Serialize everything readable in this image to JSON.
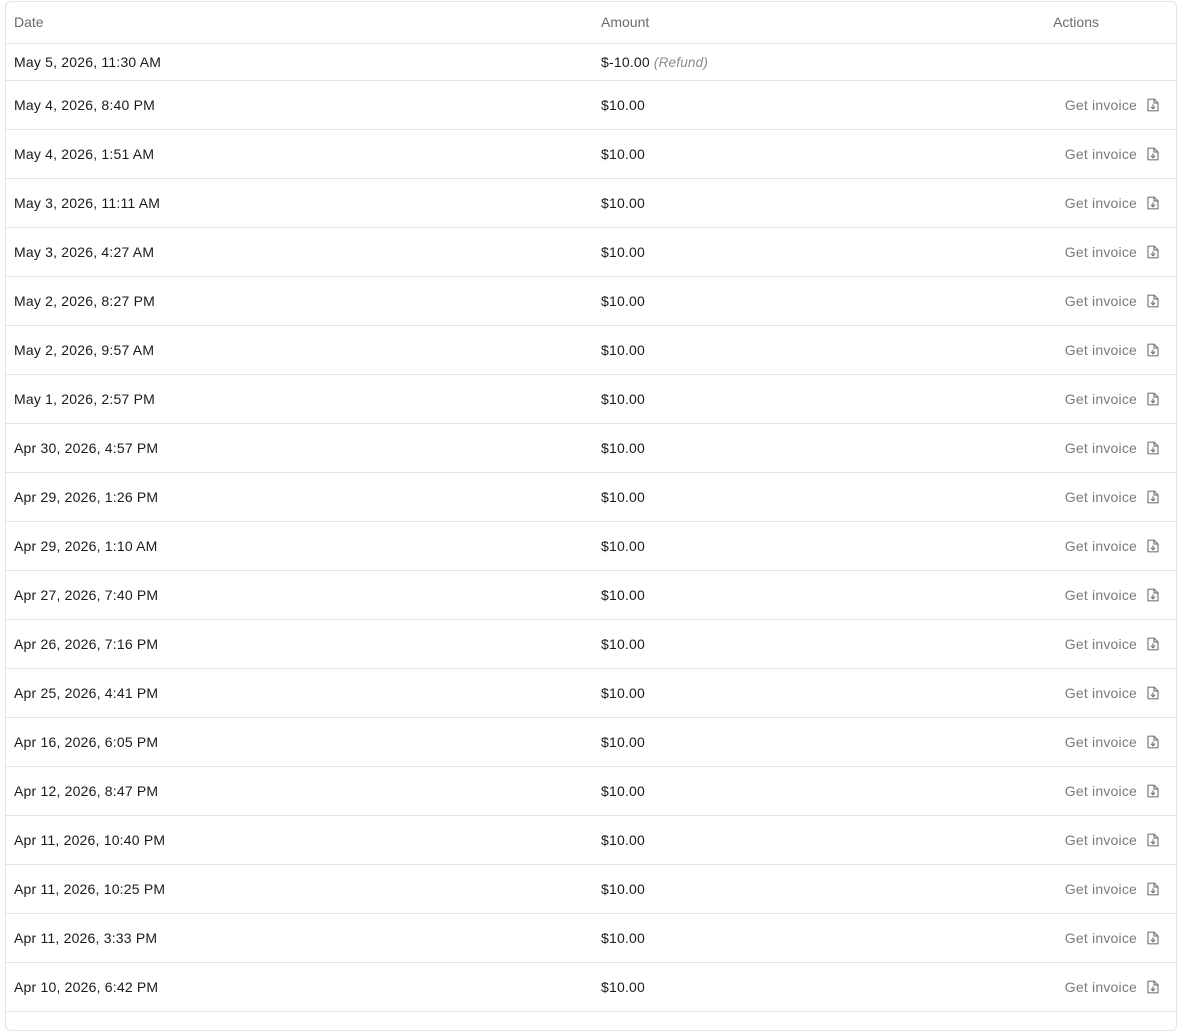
{
  "table": {
    "headers": {
      "date": "Date",
      "amount": "Amount",
      "actions": "Actions"
    },
    "rows": [
      {
        "date": "May 5, 2026, 11:30 AM",
        "amount": "$-10.00",
        "note": "(Refund)",
        "action": ""
      },
      {
        "date": "May 4, 2026, 8:40 PM",
        "amount": "$10.00",
        "note": "",
        "action": "Get invoice"
      },
      {
        "date": "May 4, 2026, 1:51 AM",
        "amount": "$10.00",
        "note": "",
        "action": "Get invoice"
      },
      {
        "date": "May 3, 2026, 11:11 AM",
        "amount": "$10.00",
        "note": "",
        "action": "Get invoice"
      },
      {
        "date": "May 3, 2026, 4:27 AM",
        "amount": "$10.00",
        "note": "",
        "action": "Get invoice"
      },
      {
        "date": "May 2, 2026, 8:27 PM",
        "amount": "$10.00",
        "note": "",
        "action": "Get invoice"
      },
      {
        "date": "May 2, 2026, 9:57 AM",
        "amount": "$10.00",
        "note": "",
        "action": "Get invoice"
      },
      {
        "date": "May 1, 2026, 2:57 PM",
        "amount": "$10.00",
        "note": "",
        "action": "Get invoice"
      },
      {
        "date": "Apr 30, 2026, 4:57 PM",
        "amount": "$10.00",
        "note": "",
        "action": "Get invoice"
      },
      {
        "date": "Apr 29, 2026, 1:26 PM",
        "amount": "$10.00",
        "note": "",
        "action": "Get invoice"
      },
      {
        "date": "Apr 29, 2026, 1:10 AM",
        "amount": "$10.00",
        "note": "",
        "action": "Get invoice"
      },
      {
        "date": "Apr 27, 2026, 7:40 PM",
        "amount": "$10.00",
        "note": "",
        "action": "Get invoice"
      },
      {
        "date": "Apr 26, 2026, 7:16 PM",
        "amount": "$10.00",
        "note": "",
        "action": "Get invoice"
      },
      {
        "date": "Apr 25, 2026, 4:41 PM",
        "amount": "$10.00",
        "note": "",
        "action": "Get invoice"
      },
      {
        "date": "Apr 16, 2026, 6:05 PM",
        "amount": "$10.00",
        "note": "",
        "action": "Get invoice"
      },
      {
        "date": "Apr 12, 2026, 8:47 PM",
        "amount": "$10.00",
        "note": "",
        "action": "Get invoice"
      },
      {
        "date": "Apr 11, 2026, 10:40 PM",
        "amount": "$10.00",
        "note": "",
        "action": "Get invoice"
      },
      {
        "date": "Apr 11, 2026, 10:25 PM",
        "amount": "$10.00",
        "note": "",
        "action": "Get invoice"
      },
      {
        "date": "Apr 11, 2026, 3:33 PM",
        "amount": "$10.00",
        "note": "",
        "action": "Get invoice"
      },
      {
        "date": "Apr 10, 2026, 6:42 PM",
        "amount": "$10.00",
        "note": "",
        "action": "Get invoice"
      }
    ]
  },
  "icons": {
    "invoice_icon": "file-invoice-icon"
  }
}
